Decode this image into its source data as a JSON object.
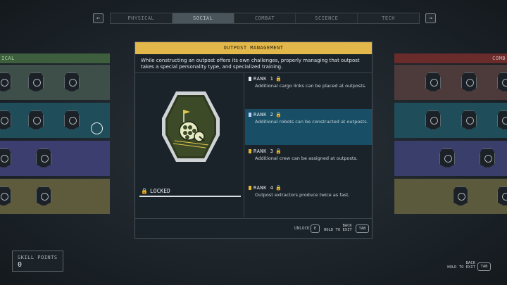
{
  "tabs": {
    "prev_key": "←",
    "next_key": "→",
    "items": [
      {
        "label": "PHYSICAL",
        "active": false
      },
      {
        "label": "SOCIAL",
        "active": true
      },
      {
        "label": "COMBAT",
        "active": false
      },
      {
        "label": "SCIENCE",
        "active": false
      },
      {
        "label": "TECH",
        "active": false
      }
    ]
  },
  "columns": {
    "left_header": "ICAL",
    "right_header": "COMB"
  },
  "modal": {
    "title": "OUTPOST MANAGEMENT",
    "description": "While constructing an outpost offers its own challenges, properly managing that outpost takes a special personality type, and specialized training.",
    "status": "LOCKED",
    "ranks": [
      {
        "label": "RANK 1",
        "text": "Additional cargo links can be placed at outposts.",
        "active": false
      },
      {
        "label": "RANK 2",
        "text": "Additional robots can be constructed at outposts.",
        "active": true
      },
      {
        "label": "RANK 3",
        "text": "Additional crew can be assigned at outposts.",
        "active": false
      },
      {
        "label": "RANK 4",
        "text": "Outpost extractors produce twice as fast.",
        "active": false
      }
    ],
    "footer": {
      "unlock_label": "UNLOCK",
      "unlock_key": "E",
      "back_label": "BACK",
      "hold_label": "HOLD TO EXIT",
      "back_key": "TAB"
    }
  },
  "skill_points": {
    "label": "SKILL POINTS",
    "value": "0"
  },
  "bottom_back": {
    "back_label": "BACK",
    "hold_label": "HOLD TO EXIT",
    "key": "TAB"
  },
  "colors": {
    "title_bar": "#e3b84a",
    "active_rank": "#184f66",
    "row_physical": "#3e5f3d",
    "row_combat": "#6a2b2b"
  }
}
